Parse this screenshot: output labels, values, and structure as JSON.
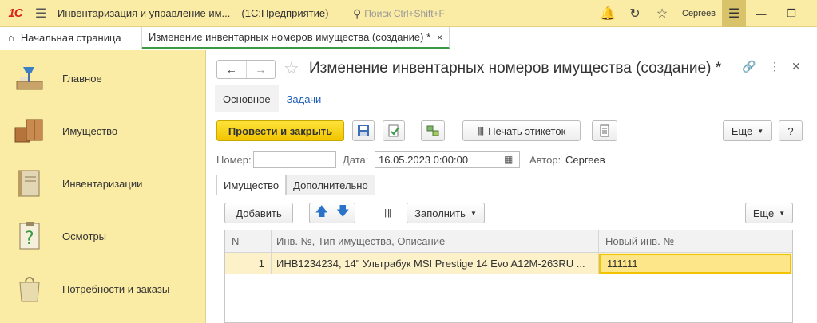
{
  "titlebar": {
    "logo": "1С",
    "title": "Инвентаризация и управление им...",
    "subtitle": "(1С:Предприятие)",
    "search_placeholder": "Поиск Ctrl+Shift+F",
    "user": "Сергеев"
  },
  "tabs": {
    "home_label": "Начальная страница",
    "doc_label": "Изменение инвентарных номеров имущества (создание) *",
    "close_glyph": "×"
  },
  "sidebar": {
    "items": [
      {
        "label": "Главное",
        "icon": "desk-lamp-icon"
      },
      {
        "label": "Имущество",
        "icon": "boxes-icon"
      },
      {
        "label": "Инвентаризации",
        "icon": "book-icon"
      },
      {
        "label": "Осмотры",
        "icon": "clipboard-question-icon"
      },
      {
        "label": "Потребности и заказы",
        "icon": "shopping-bag-icon"
      }
    ]
  },
  "form": {
    "title": "Изменение инвентарных номеров имущества (создание) *",
    "subtabs": {
      "main": "Основное",
      "tasks": "Задачи"
    },
    "toolbar": {
      "post_close": "Провести и закрыть",
      "print_labels": "Печать этикеток",
      "more": "Еще",
      "help": "?"
    },
    "fields": {
      "number_label": "Номер:",
      "number_value": "",
      "date_label": "Дата:",
      "date_value": "16.05.2023  0:00:00",
      "author_label": "Автор:",
      "author_value": "Сергеев"
    },
    "inner_tabs": {
      "property": "Имущество",
      "additional": "Дополнительно"
    },
    "table_toolbar": {
      "add": "Добавить",
      "fill": "Заполнить",
      "more": "Еще"
    },
    "table": {
      "headers": [
        "N",
        "Инв. №, Тип имущества, Описание",
        "Новый инв. №"
      ],
      "rows": [
        {
          "n": "1",
          "desc": "ИНВ1234234, 14\" Ультрабук MSI Prestige 14 Evo A12M-263RU ...",
          "new_num": "111111"
        }
      ]
    }
  },
  "colors": {
    "accent_yellow": "#f2c400",
    "sidebar_bg": "#fbeca5",
    "link": "#1f5fb5",
    "active_tab_underline": "#3a9a43"
  }
}
